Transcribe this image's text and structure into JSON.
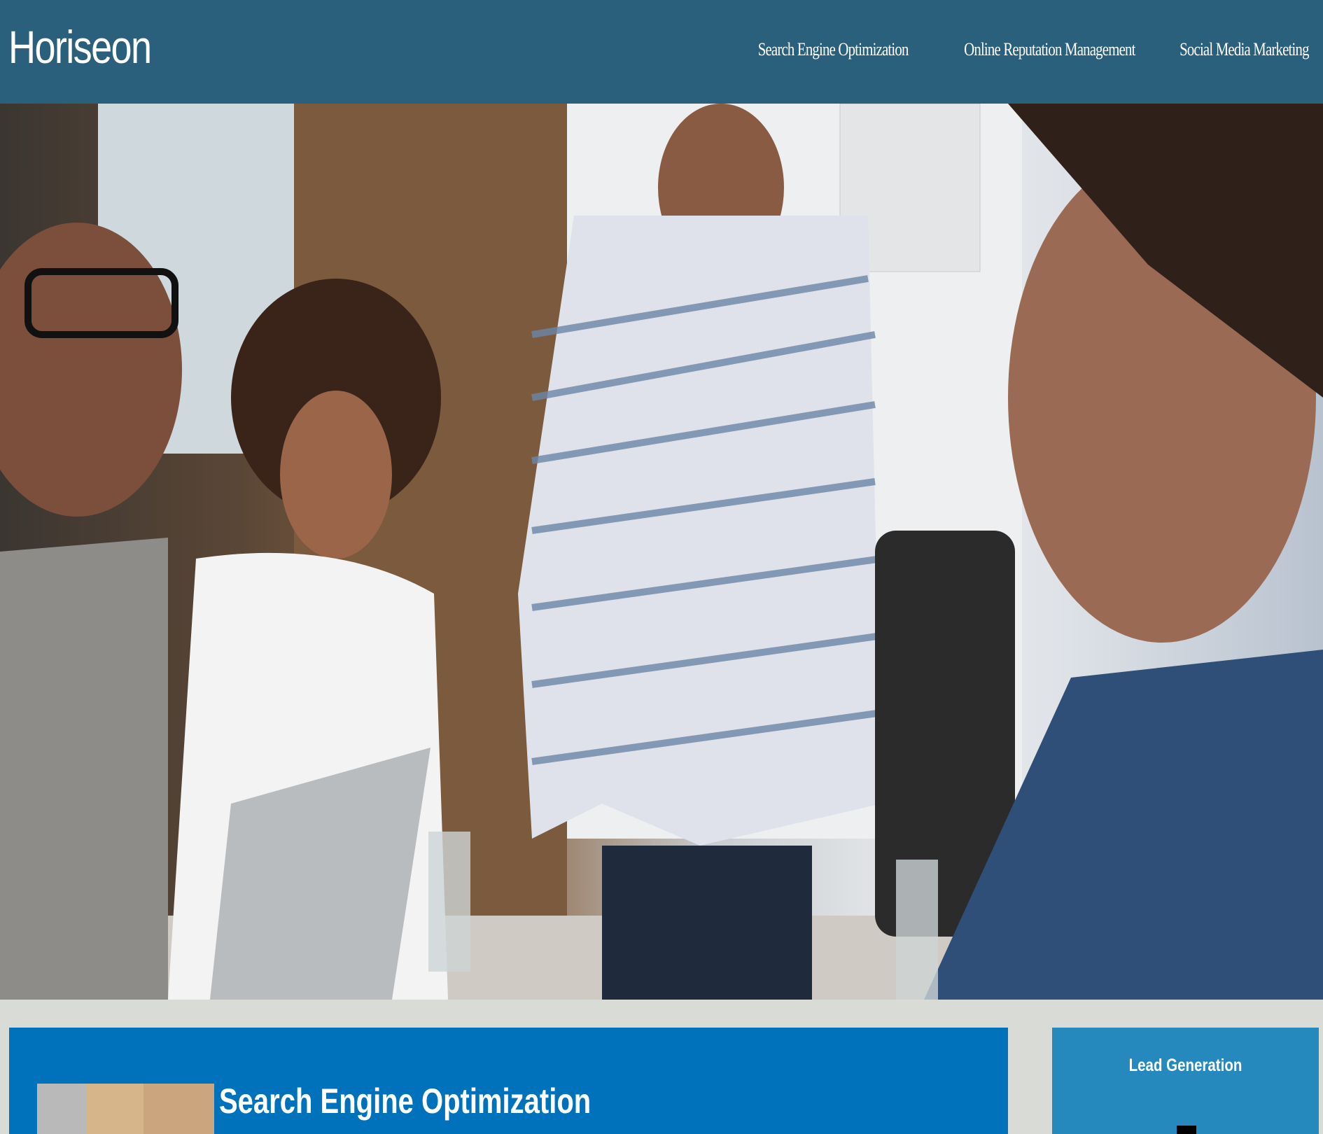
{
  "header": {
    "logo": "Horiseon",
    "nav": [
      {
        "label": "Search Engine Optimization"
      },
      {
        "label": "Online Reputation Management"
      },
      {
        "label": "Social Media Marketing"
      }
    ]
  },
  "hero": {
    "image_description": "Team meeting photo"
  },
  "content": {
    "card": {
      "title": "Search Engine Optimization"
    }
  },
  "aside": {
    "title": "Lead Generation"
  },
  "colors": {
    "header_bg": "#2a607c",
    "card_bg": "#0072bb",
    "aside_bg": "#2589bd",
    "page_bg": "#d9dcd6"
  }
}
